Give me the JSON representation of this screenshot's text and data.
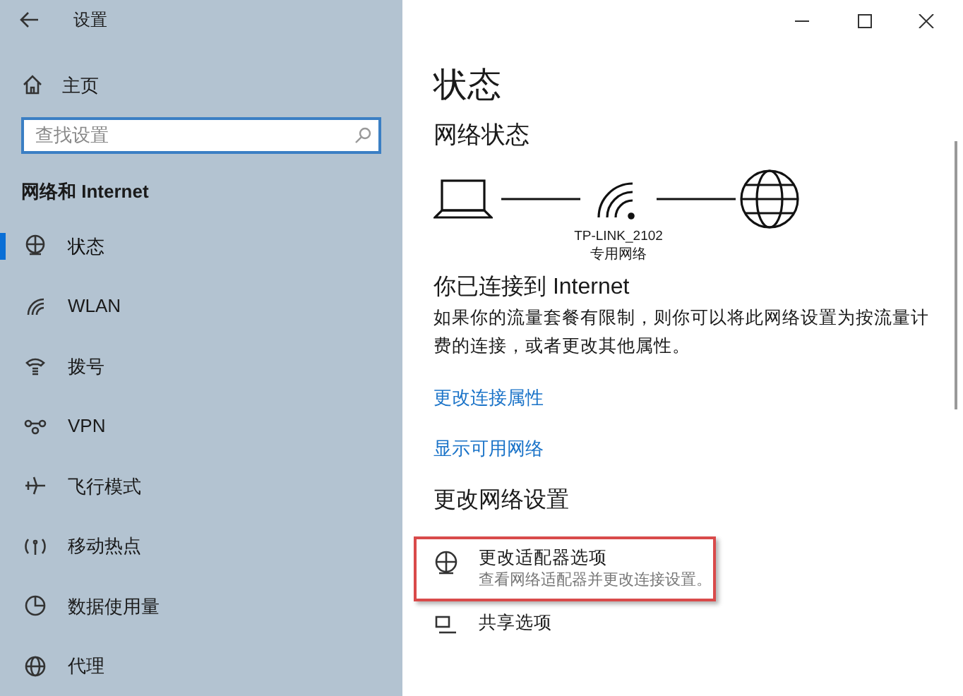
{
  "window": {
    "title": "设置"
  },
  "sidebar": {
    "home": "主页",
    "search": {
      "placeholder": "查找设置"
    },
    "section": "网络和 Internet",
    "items": [
      {
        "label": "状态",
        "kind": "status",
        "selected": true
      },
      {
        "label": "WLAN",
        "kind": "wlan",
        "selected": false
      },
      {
        "label": "拨号",
        "kind": "dialup",
        "selected": false
      },
      {
        "label": "VPN",
        "kind": "vpn",
        "selected": false
      },
      {
        "label": "飞行模式",
        "kind": "airplane",
        "selected": false
      },
      {
        "label": "移动热点",
        "kind": "hotspot",
        "selected": false
      },
      {
        "label": "数据使用量",
        "kind": "data",
        "selected": false
      },
      {
        "label": "代理",
        "kind": "proxy",
        "selected": false
      }
    ]
  },
  "main": {
    "title": "状态",
    "network_heading": "网络状态",
    "diagram": {
      "network_name": "TP-LINK_2102",
      "network_type": "专用网络"
    },
    "connected_heading": "你已连接到 Internet",
    "description": "如果你的流量套餐有限制，则你可以将此网络设置为按流量计费的连接，或者更改其他属性。",
    "links": [
      "更改连接属性",
      "显示可用网络"
    ],
    "change_heading": "更改网络设置",
    "options": [
      {
        "kind": "adapter",
        "title": "更改适配器选项",
        "description": "查看网络适配器并更改连接设置。",
        "highlighted": true
      },
      {
        "kind": "sharing",
        "title": "共享选项",
        "highlighted": false
      }
    ]
  }
}
